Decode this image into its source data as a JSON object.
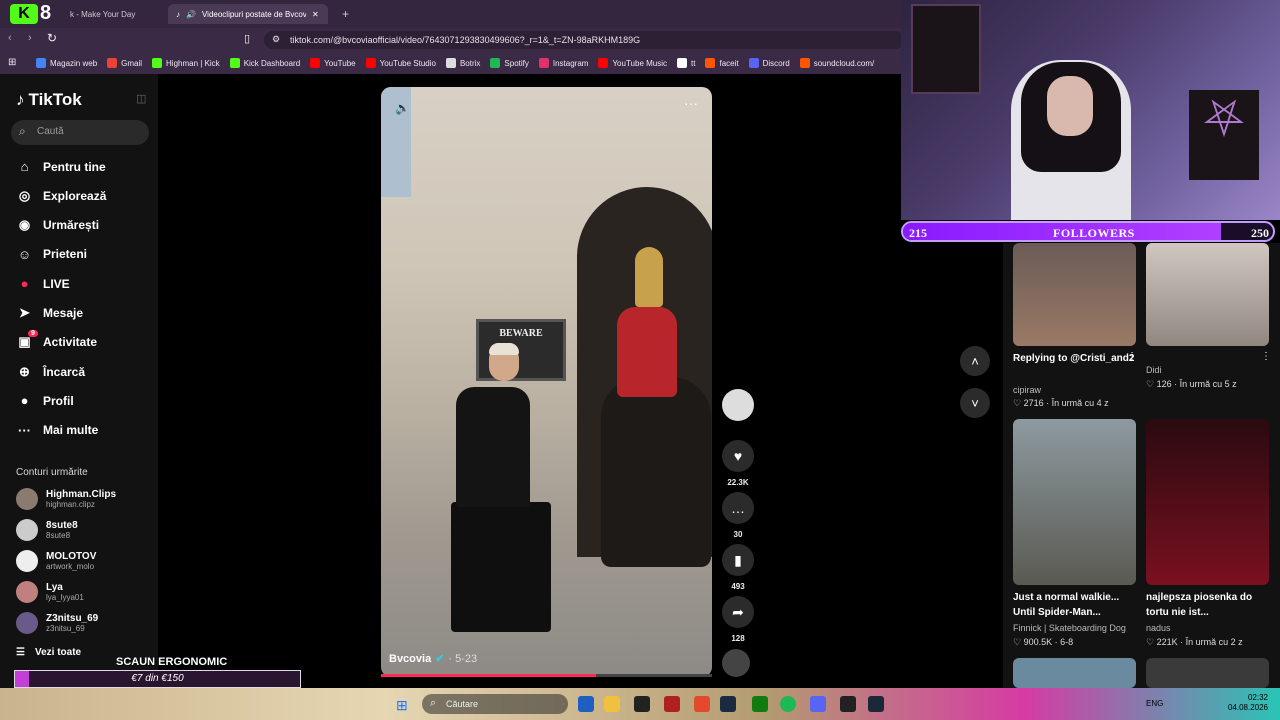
{
  "browser": {
    "tab1_label": "k - Make Your Day",
    "tab2_label": "Videoclipuri postate de Bvcov",
    "url": "tiktok.com/@bvcoviaofficial/video/7643071293830499606?_r=1&_t=ZN-98aRKHM189G",
    "bookmarks": [
      "Magazin web",
      "Gmail",
      "Highman | Kick",
      "Kick Dashboard",
      "YouTube",
      "YouTube Studio",
      "Botrix",
      "Spotify",
      "Instagram",
      "YouTube Music",
      "tt",
      "faceit",
      "Discord",
      "soundcloud.com/"
    ]
  },
  "sidebar": {
    "logo": "TikTok",
    "search_placeholder": "Caută",
    "nav": [
      "Pentru tine",
      "Explorează",
      "Urmărești",
      "Prieteni",
      "LIVE",
      "Mesaje",
      "Activitate",
      "Încarcă",
      "Profil",
      "Mai multe"
    ],
    "activity_badge": "9",
    "following_title": "Conturi urmărite",
    "following": [
      {
        "name": "Highman.Clips",
        "user": "highman.clipz"
      },
      {
        "name": "8sute8",
        "user": "8sute8"
      },
      {
        "name": "MOLOTOV",
        "user": "artwork_molo"
      },
      {
        "name": "Lya",
        "user": "lya_lyya01"
      },
      {
        "name": "Z3nitsu_69",
        "user": "z3nitsu_69"
      }
    ],
    "see_all": "Vezi toate"
  },
  "video": {
    "sign_text": "BEWARE",
    "author": "Bvcovia",
    "date": "· 5-23",
    "progress": 0.65,
    "likes": "22.3K",
    "comments": "30",
    "saves": "493",
    "shares": "128"
  },
  "followers_bar": {
    "current": "215",
    "label": "FOLLOWERS",
    "goal": "250",
    "progress": 0.86
  },
  "grid": [
    {
      "title": "Replying to @Cristi_and2",
      "author": "cipiraw",
      "meta": "2716 · În urmă cu 4 z"
    },
    {
      "title": "",
      "author": "Didi",
      "meta": "126 · În urmă cu 5 z"
    },
    {
      "title": "Just a normal walkie... Until Spider-Man...",
      "author": "Finnick | Skateboarding Dog",
      "meta": "900.5K · 6-8"
    },
    {
      "title": "najlepsza piosenka do tortu nie ist...",
      "author": "nadus",
      "meta": "221K · În urmă cu 2 z"
    }
  ],
  "stream_overlay": {
    "chair_label": "SCAUN ERGONOMIC",
    "goal_label": "€7 din €150",
    "goal_progress": 0.05
  },
  "taskbar": {
    "search_label": "Căutare",
    "lang": "ENG",
    "time": "02:32",
    "date": "04.08.2026"
  }
}
